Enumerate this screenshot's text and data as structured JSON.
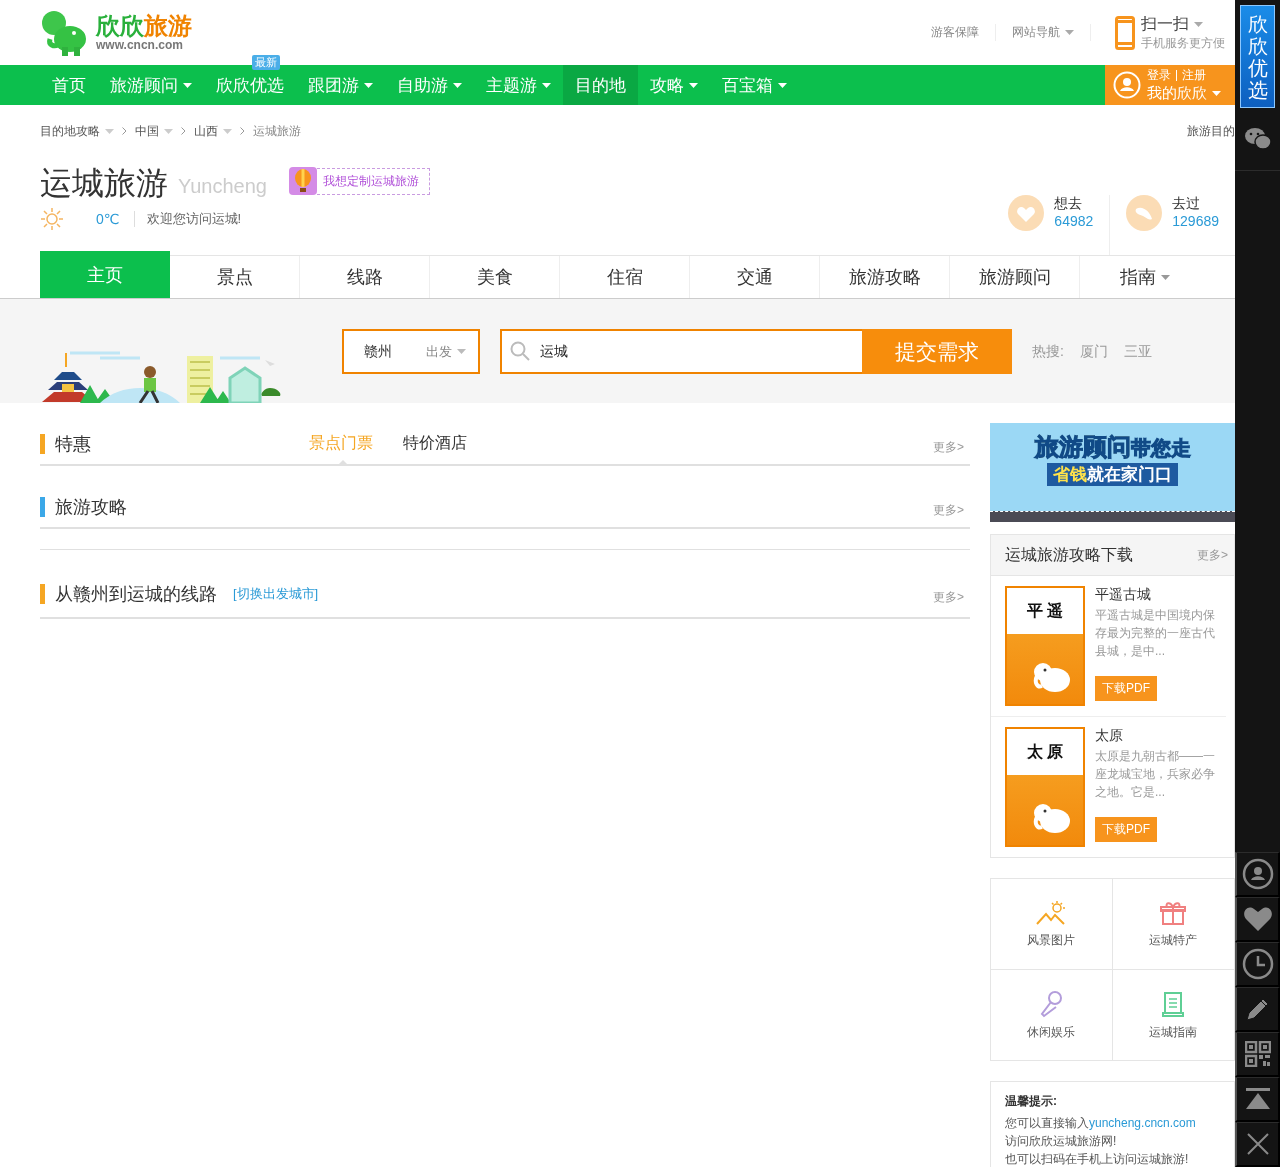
{
  "header": {
    "logo": {
      "brand_parts": [
        "欣欣",
        "旅游"
      ],
      "domain": "www.cncn.com"
    },
    "links": [
      {
        "label": "游客保障",
        "dropdown": false
      },
      {
        "label": "网站导航",
        "dropdown": true
      }
    ],
    "mobile": {
      "title": "扫一扫",
      "subtitle": "手机服务更方便"
    }
  },
  "nav": {
    "items": [
      {
        "label": "首页",
        "dropdown": false,
        "selected": false
      },
      {
        "label": "旅游顾问",
        "dropdown": true,
        "selected": false
      },
      {
        "label": "欣欣优选",
        "dropdown": false,
        "selected": false,
        "badge": "最新"
      },
      {
        "label": "跟团游",
        "dropdown": true,
        "selected": false
      },
      {
        "label": "自助游",
        "dropdown": true,
        "selected": false
      },
      {
        "label": "主题游",
        "dropdown": true,
        "selected": false
      },
      {
        "label": "目的地",
        "dropdown": false,
        "selected": true
      },
      {
        "label": "攻略",
        "dropdown": true,
        "selected": false
      },
      {
        "label": "百宝箱",
        "dropdown": true,
        "selected": false
      }
    ],
    "account": {
      "login": "登录",
      "register": "注册",
      "label": "我的欣欣"
    }
  },
  "breadcrumb": {
    "items": [
      {
        "label": "目的地攻略",
        "dropdown": true
      },
      {
        "label": "中国",
        "dropdown": true
      },
      {
        "label": "山西",
        "dropdown": true
      },
      {
        "label": "运城旅游",
        "dropdown": false
      }
    ],
    "right_link": "旅游目的"
  },
  "destination": {
    "title": "运城旅游",
    "pinyin": "Yuncheng",
    "custom_tag": "我想定制运城旅游",
    "temperature": "0℃",
    "welcome": "欢迎您访问运城!",
    "stats": [
      {
        "kind": "want",
        "label": "想去",
        "count": "64982"
      },
      {
        "kind": "been",
        "label": "去过",
        "count": "129689"
      }
    ]
  },
  "tabs": [
    {
      "label": "主页",
      "selected": true,
      "dropdown": false
    },
    {
      "label": "景点",
      "selected": false,
      "dropdown": false
    },
    {
      "label": "线路",
      "selected": false,
      "dropdown": false
    },
    {
      "label": "美食",
      "selected": false,
      "dropdown": false
    },
    {
      "label": "住宿",
      "selected": false,
      "dropdown": false
    },
    {
      "label": "交通",
      "selected": false,
      "dropdown": false
    },
    {
      "label": "旅游攻略",
      "selected": false,
      "dropdown": false
    },
    {
      "label": "旅游顾问",
      "selected": false,
      "dropdown": false
    },
    {
      "label": "指南",
      "selected": false,
      "dropdown": true
    }
  ],
  "search": {
    "from_city": "赣州",
    "from_label": "出发",
    "value": "运城",
    "button": "提交需求",
    "hot_label": "热搜:",
    "hot": [
      "厦门",
      "三亚"
    ]
  },
  "sections": [
    {
      "kind": "header",
      "title": "特惠",
      "color": "#f5a623",
      "tabs": [
        {
          "label": "景点门票",
          "selected": true
        },
        {
          "label": "特价酒店",
          "selected": false
        }
      ],
      "more": "更多>"
    },
    {
      "kind": "header",
      "title": "旅游攻略",
      "color": "#3ba8e8",
      "more": "更多>"
    },
    {
      "kind": "divider"
    },
    {
      "kind": "header",
      "title": "从赣州到运城的线路",
      "color": "#f5a623",
      "link": "[切换出发城市]",
      "more": "更多>"
    }
  ],
  "banner": {
    "headline_a": "旅游顾问",
    "headline_b": "带您走",
    "subline_a": "省钱",
    "subline_b": "就在家门口"
  },
  "downloads": {
    "title": "运城旅游攻略下载",
    "more": "更多>",
    "items": [
      {
        "cover_title": "平 遥",
        "name": "平遥古城",
        "description": "平遥古城是中国境内保存最为完整的一座古代县城，是中...",
        "button": "下载PDF"
      },
      {
        "cover_title": "太 原",
        "name": "太原",
        "description": "太原是九朝古都——一座龙城宝地，兵家必争之地。它是...",
        "button": "下载PDF"
      }
    ]
  },
  "features": [
    {
      "kind": "scenery",
      "label": "风景图片"
    },
    {
      "kind": "gift",
      "label": "运城特产"
    },
    {
      "kind": "mic",
      "label": "休闲娱乐"
    },
    {
      "kind": "scroll",
      "label": "运城指南"
    }
  ],
  "tips": {
    "title": "温馨提示:",
    "lines": [
      {
        "text": "您可以直接输入",
        "link": "yuncheng.cncn.com"
      },
      {
        "text": "访问欣欣运城旅游网!"
      },
      {
        "text": "也可以扫码在手机上访问运城旅游!"
      }
    ]
  },
  "sidebar": {
    "promo": "欣欣优选",
    "tools": [
      {
        "kind": "user"
      },
      {
        "kind": "heart"
      },
      {
        "kind": "clock"
      },
      {
        "kind": "pencil"
      },
      {
        "kind": "qrcode"
      },
      {
        "kind": "top"
      },
      {
        "kind": "close"
      }
    ]
  }
}
